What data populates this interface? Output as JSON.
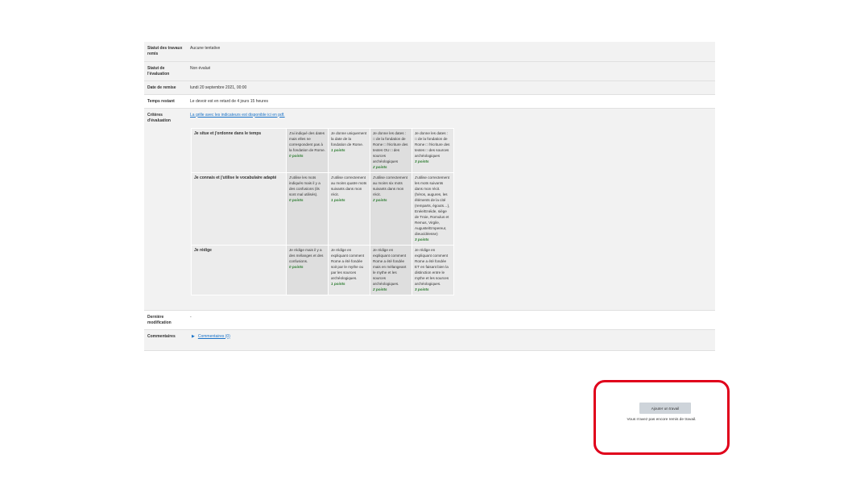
{
  "status": {
    "submission_status_label": "Statut des travaux remis",
    "submission_status_value": "Aucune tentative",
    "grading_status_label": "Statut de l'évaluation",
    "grading_status_value": "Non évalué",
    "due_date_label": "Date de remise",
    "due_date_value": "lundi 20 septembre 2021, 00:00",
    "time_remaining_label": "Temps restant",
    "time_remaining_value": "Le devoir est en retard de 4 jours 15 heures",
    "criteria_label": "Critères d'évaluation",
    "criteria_link": "La grille avec les indicateurs est disponible ici en pdf.",
    "last_modified_label": "Dernière modification",
    "last_modified_value": "-",
    "comments_label": "Commentaires",
    "comments_link": "Commentaires (0)"
  },
  "rubric": [
    {
      "criterion": "Je situe et j'ordonne dans le temps",
      "levels": [
        {
          "text": "J'ai indiqué des dates mais elles ne correspondent pas à la fondation de Rome.",
          "points": "0 points"
        },
        {
          "text": "Je donne uniquement la date de la fondation de Rome.",
          "points": "1 points"
        },
        {
          "text": "Je donne les dates : □ de la fondation de Rome □ l'écriture des textes OU □ des sources archéologiques",
          "points": "2 points"
        },
        {
          "text": "Je donne les dates : □ de la fondation de Rome □ l'écriture des textes □ des sources archéologiques",
          "points": "3 points"
        }
      ]
    },
    {
      "criterion": "Je connais et j'utilise le vocabulaire adapté",
      "levels": [
        {
          "text": "J'utilise les mots indiqués mais il y a des confusions (ils sont mal utilisés).",
          "points": "0 points"
        },
        {
          "text": "J'utilise correctement au moins quatre mots suivants dans mon récit.",
          "points": "1 points"
        },
        {
          "text": "J'utilise correctement au moins six mots suivants dans mon récit.",
          "points": "2 points"
        },
        {
          "text": "J'utilise correctement les mots suivants dans mon récit. (héros, augures, les éléments de la cité (remparts, égouts…), Enée/Enéide, siège de Troie, Romulus et Remus, Virgile, Auguste/Empereur, dieux/déesse)",
          "points": "3 points"
        }
      ]
    },
    {
      "criterion": "Je rédige",
      "levels": [
        {
          "text": "Je rédige mais il y a des mélanges et des confusions.",
          "points": "0 points"
        },
        {
          "text": "Je rédige en expliquant comment Rome a été fondée soit par le mythe ou par les sources archéologiques.",
          "points": "1 points"
        },
        {
          "text": "Je rédige en expliquant comment Rome a été fondée mais en mélangeant le mythe et les sources archéologiques.",
          "points": "2 points"
        },
        {
          "text": "Je rédige en expliquant comment Rome a été fondée ET en faisant bien la distinction entre le mythe et les sources archéologiques.",
          "points": "3 points"
        }
      ]
    }
  ],
  "actions": {
    "add_submission_label": "Ajouter un travail",
    "no_submission_text": "Vous n'avez pas encore remis de travail."
  },
  "colors": {
    "highlight_border": "#e0001b",
    "link": "#1a73c8",
    "warning": "#f0ad4e",
    "points": "#2e7d32"
  }
}
